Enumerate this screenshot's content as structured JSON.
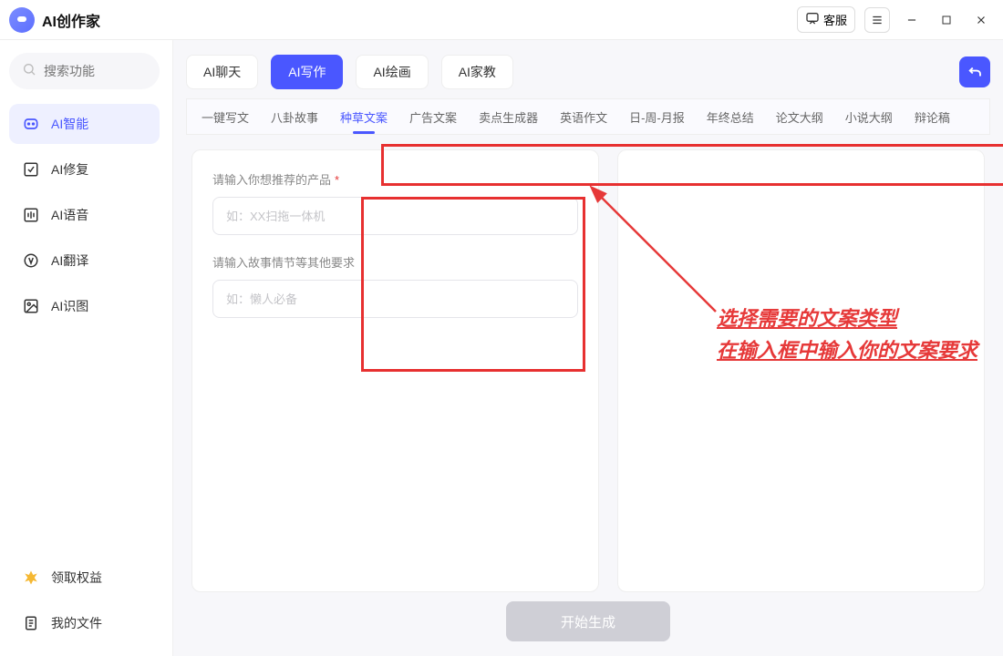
{
  "title": "AI创作家",
  "titlebar": {
    "service_label": "客服"
  },
  "sidebar": {
    "search_placeholder": "搜索功能",
    "items": [
      {
        "label": "AI智能",
        "active": true
      },
      {
        "label": "AI修复",
        "active": false
      },
      {
        "label": "AI语音",
        "active": false
      },
      {
        "label": "AI翻译",
        "active": false
      },
      {
        "label": "AI识图",
        "active": false
      }
    ],
    "bottom": [
      {
        "label": "领取权益"
      },
      {
        "label": "我的文件"
      }
    ]
  },
  "top_tabs": [
    {
      "label": "AI聊天",
      "active": false
    },
    {
      "label": "AI写作",
      "active": true
    },
    {
      "label": "AI绘画",
      "active": false
    },
    {
      "label": "AI家教",
      "active": false
    }
  ],
  "subtabs": [
    {
      "label": "一键写文",
      "active": false
    },
    {
      "label": "八卦故事",
      "active": false
    },
    {
      "label": "种草文案",
      "active": true
    },
    {
      "label": "广告文案",
      "active": false
    },
    {
      "label": "卖点生成器",
      "active": false
    },
    {
      "label": "英语作文",
      "active": false
    },
    {
      "label": "日-周-月报",
      "active": false
    },
    {
      "label": "年终总结",
      "active": false
    },
    {
      "label": "论文大纲",
      "active": false
    },
    {
      "label": "小说大纲",
      "active": false
    },
    {
      "label": "辩论稿",
      "active": false
    }
  ],
  "form": {
    "field1_label": "请输入你想推荐的产品",
    "field1_placeholder": "如：XX扫拖一体机",
    "field2_label": "请输入故事情节等其他要求",
    "field2_placeholder": "如：懒人必备",
    "generate_label": "开始生成"
  },
  "annotation": {
    "line1": "选择需要的文案类型",
    "line2": "在输入框中输入你的文案要求"
  }
}
